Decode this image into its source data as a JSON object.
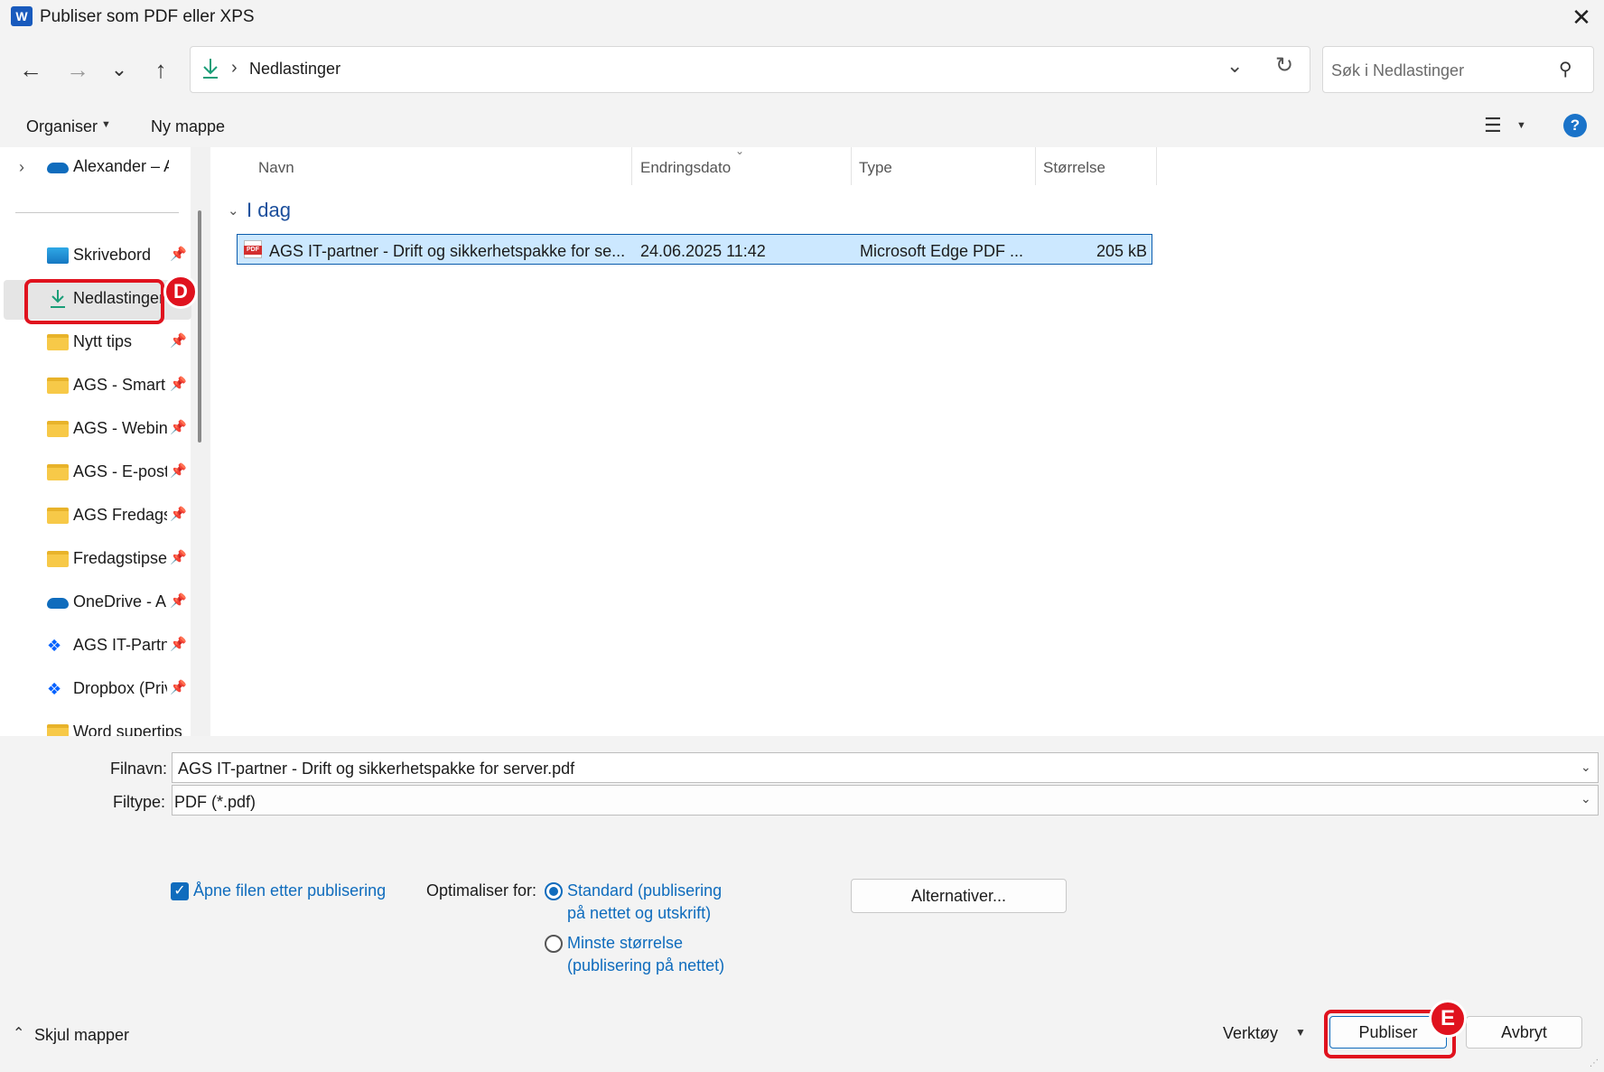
{
  "window": {
    "title": "Publiser som PDF eller XPS",
    "app_icon": "W"
  },
  "nav": {
    "back": "←",
    "forward": "→",
    "recent": "⌄",
    "up": "↑",
    "breadcrumb_sep": "›",
    "location": "Nedlastinger",
    "search_placeholder": "Søk i Nedlastinger"
  },
  "toolbar": {
    "organise": "Organiser",
    "new_folder": "Ny mappe",
    "help": "?"
  },
  "sidebar": {
    "top_item": "Alexander – AGS",
    "items": [
      {
        "label": "Skrivebord",
        "icon": "desktop-icon",
        "pinned": true
      },
      {
        "label": "Nedlastinger",
        "icon": "download-icon",
        "pinned": false,
        "selected": true
      },
      {
        "label": "Nytt tips",
        "icon": "folder-icon",
        "pinned": true
      },
      {
        "label": "AGS - Smart",
        "icon": "folder-icon",
        "pinned": true
      },
      {
        "label": "AGS - Webinar",
        "icon": "folder-icon",
        "pinned": true
      },
      {
        "label": "AGS - E-post",
        "icon": "folder-icon",
        "pinned": true
      },
      {
        "label": "AGS Fredagstips",
        "icon": "folder-icon",
        "pinned": true
      },
      {
        "label": "Fredagstipset",
        "icon": "folder-icon",
        "pinned": true
      },
      {
        "label": "OneDrive - A",
        "icon": "onedrive-icon",
        "pinned": true
      },
      {
        "label": "AGS IT-Partner",
        "icon": "dropbox-icon",
        "pinned": true
      },
      {
        "label": "Dropbox (Privat)",
        "icon": "dropbox-icon",
        "pinned": true
      },
      {
        "label": "Word supertips",
        "icon": "folder-icon",
        "pinned": false
      }
    ]
  },
  "filelist": {
    "columns": [
      "Navn",
      "Endringsdato",
      "Type",
      "Størrelse"
    ],
    "group": "I dag",
    "files": [
      {
        "name": "AGS IT-partner - Drift og sikkerhetspakke for se...",
        "date": "24.06.2025 11:42",
        "type": "Microsoft Edge PDF ...",
        "size": "205 kB",
        "icon_tag": "PDF"
      }
    ]
  },
  "form": {
    "filename_label": "Filnavn:",
    "filename_value": "AGS IT-partner - Drift og sikkerhetspakke for server.pdf",
    "filetype_label": "Filtype:",
    "filetype_value": "PDF (*.pdf)",
    "open_after_label": "Åpne filen etter publisering",
    "open_after_checked": true,
    "optimize_label": "Optimaliser for:",
    "opt_standard_line1": "Standard (publisering",
    "opt_standard_line2": "på nettet og utskrift)",
    "opt_min_line1": "Minste størrelse",
    "opt_min_line2": "(publisering på nettet)",
    "options_button": "Alternativer..."
  },
  "footer": {
    "hide_folders": "Skjul mapper",
    "tools": "Verktøy",
    "publish": "Publiser",
    "cancel": "Avbryt"
  },
  "annotations": {
    "d": "D",
    "e": "E"
  },
  "colors": {
    "accent": "#0f6cbd",
    "annotation": "#e0121e",
    "selection": "#cce8ff"
  }
}
